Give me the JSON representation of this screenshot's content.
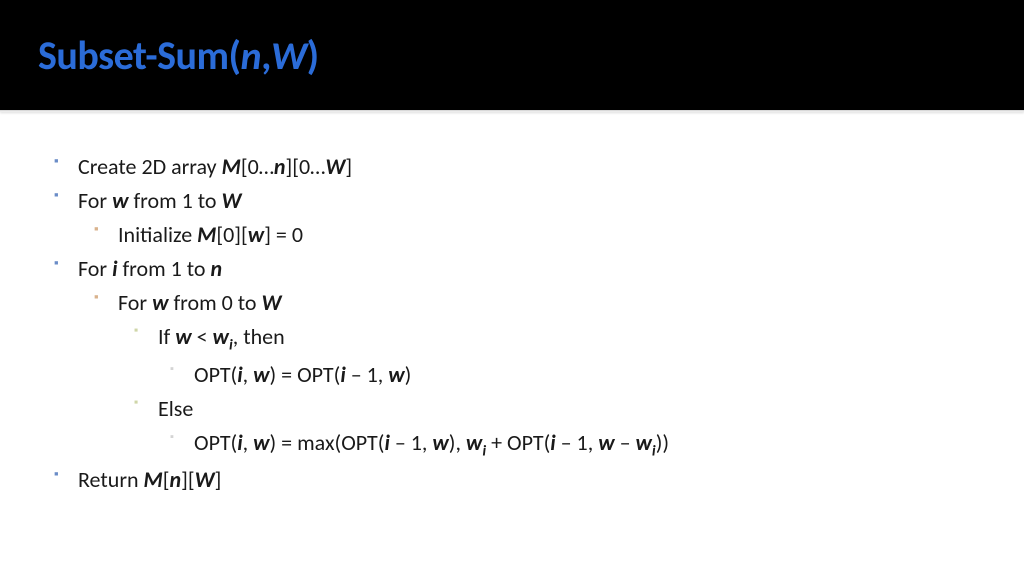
{
  "title": {
    "prefix": "Subset-Sum(",
    "arg1": "n",
    "sep": ",",
    "arg2": "W",
    "suffix": ")"
  },
  "lines": {
    "l1a": "Create 2D array ",
    "l1b": "M",
    "l1c": "[0…",
    "l1d": "n",
    "l1e": "][0…",
    "l1f": "W",
    "l1g": "]",
    "l2a": "For ",
    "l2b": "w",
    "l2c": " from 1 to ",
    "l2d": "W",
    "l3a": "Initialize ",
    "l3b": "M",
    "l3c": "[0][",
    "l3d": "w",
    "l3e": "] = 0",
    "l4a": "For ",
    "l4b": "i",
    "l4c": " from 1 to ",
    "l4d": "n",
    "l5a": "For ",
    "l5b": "w",
    "l5c": " from 0 to ",
    "l5d": "W",
    "l6a": "If ",
    "l6b": "w",
    "l6c": " < ",
    "l6d": "w",
    "l6e": "i",
    "l6f": ", then",
    "l7a": "OPT(",
    "l7b": "i",
    "l7c": ", ",
    "l7d": "w",
    "l7e": ") = OPT(",
    "l7f": "i",
    "l7g": " – 1, ",
    "l7h": "w",
    "l7i": ")",
    "l8a": "Else",
    "l9a": "OPT(",
    "l9b": "i",
    "l9c": ", ",
    "l9d": "w",
    "l9e": ") = max(OPT(",
    "l9f": "i",
    "l9g": " – 1, ",
    "l9h": "w",
    "l9i": "), ",
    "l9j": "w",
    "l9k": "i",
    "l9l": " + OPT(",
    "l9m": "i",
    "l9n": " – 1, ",
    "l9o": "w",
    "l9p": " – ",
    "l9q": "w",
    "l9r": "i",
    "l9s": "))",
    "l10a": "Return ",
    "l10b": "M",
    "l10c": "[",
    "l10d": "n",
    "l10e": "][",
    "l10f": "W",
    "l10g": "]"
  }
}
